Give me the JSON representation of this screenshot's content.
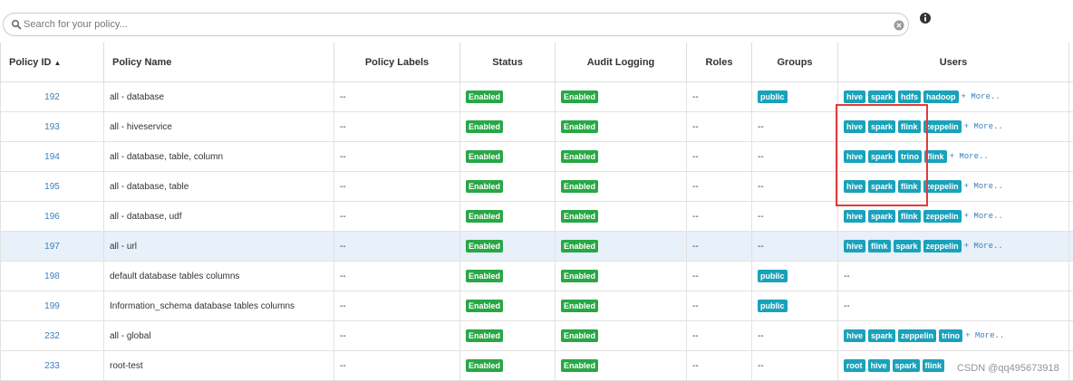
{
  "search": {
    "placeholder": "Search for your policy..."
  },
  "columns": {
    "policy_id": "Policy ID",
    "policy_name": "Policy Name",
    "policy_labels": "Policy Labels",
    "status": "Status",
    "audit_logging": "Audit Logging",
    "roles": "Roles",
    "groups": "Groups",
    "users": "Users"
  },
  "sort_indicator": "▲",
  "colors": {
    "enabled_badge": "#28a745",
    "tag_badge": "#19a2bb",
    "link": "#3a7fbd",
    "highlight_row": "#e8f0fa",
    "annotation_box": "#e23a3a"
  },
  "icons": {
    "search": "search-icon",
    "clear": "clear-icon",
    "info": "info-icon"
  },
  "rows": [
    {
      "id": "192",
      "name": "all - database",
      "labels": "--",
      "status": "Enabled",
      "audit": "Enabled",
      "roles": "--",
      "groups": [
        "public"
      ],
      "users": [
        "hive",
        "spark",
        "hdfs",
        "hadoop"
      ],
      "more": "+ More..",
      "highlight": false
    },
    {
      "id": "193",
      "name": "all - hiveservice",
      "labels": "--",
      "status": "Enabled",
      "audit": "Enabled",
      "roles": "--",
      "groups": "--",
      "users": [
        "hive",
        "spark",
        "flink",
        "zeppelin"
      ],
      "more": "+ More..",
      "highlight": false
    },
    {
      "id": "194",
      "name": "all - database, table, column",
      "labels": "--",
      "status": "Enabled",
      "audit": "Enabled",
      "roles": "--",
      "groups": "--",
      "users": [
        "hive",
        "spark",
        "trino",
        "flink"
      ],
      "more": "+ More..",
      "highlight": false
    },
    {
      "id": "195",
      "name": "all - database, table",
      "labels": "--",
      "status": "Enabled",
      "audit": "Enabled",
      "roles": "--",
      "groups": "--",
      "users": [
        "hive",
        "spark",
        "flink",
        "zeppelin"
      ],
      "more": "+ More..",
      "highlight": false
    },
    {
      "id": "196",
      "name": "all - database, udf",
      "labels": "--",
      "status": "Enabled",
      "audit": "Enabled",
      "roles": "--",
      "groups": "--",
      "users": [
        "hive",
        "spark",
        "flink",
        "zeppelin"
      ],
      "more": "+ More..",
      "highlight": false
    },
    {
      "id": "197",
      "name": "all - url",
      "labels": "--",
      "status": "Enabled",
      "audit": "Enabled",
      "roles": "--",
      "groups": "--",
      "users": [
        "hive",
        "flink",
        "spark",
        "zeppelin"
      ],
      "more": "+ More..",
      "highlight": true
    },
    {
      "id": "198",
      "name": "default database tables columns",
      "labels": "--",
      "status": "Enabled",
      "audit": "Enabled",
      "roles": "--",
      "groups": [
        "public"
      ],
      "users": "--",
      "more": "",
      "highlight": false
    },
    {
      "id": "199",
      "name": "Information_schema database tables columns",
      "labels": "--",
      "status": "Enabled",
      "audit": "Enabled",
      "roles": "--",
      "groups": [
        "public"
      ],
      "users": "--",
      "more": "",
      "highlight": false
    },
    {
      "id": "232",
      "name": "all - global",
      "labels": "--",
      "status": "Enabled",
      "audit": "Enabled",
      "roles": "--",
      "groups": "--",
      "users": [
        "hive",
        "spark",
        "zeppelin",
        "trino"
      ],
      "more": "+ More..",
      "highlight": false
    },
    {
      "id": "233",
      "name": "root-test",
      "labels": "--",
      "status": "Enabled",
      "audit": "Enabled",
      "roles": "--",
      "groups": "--",
      "users": [
        "root",
        "hive",
        "spark",
        "flink"
      ],
      "more": "",
      "highlight": false
    }
  ],
  "watermark": "CSDN @qq495673918"
}
